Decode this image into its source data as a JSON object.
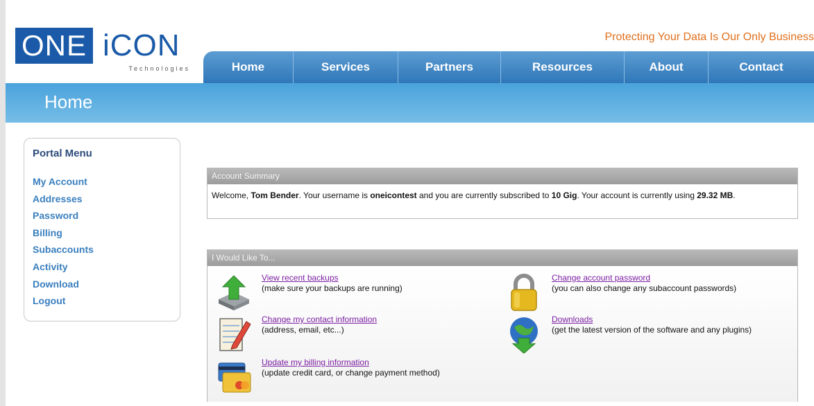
{
  "brand": {
    "logo_one": "ONE",
    "logo_icon": "iCON",
    "logo_sub": "Technologies",
    "tagline": "Protecting Your Data Is Our Only Business",
    "colors": {
      "brand_blue": "#1a5aa8",
      "tagline_orange": "#e0701c",
      "nav_blue": "#2f77b8",
      "banner_blue": "#4aa3dc",
      "link_purple": "#7b1fa2"
    }
  },
  "nav": {
    "items": [
      {
        "label": "Home"
      },
      {
        "label": "Services"
      },
      {
        "label": "Partners"
      },
      {
        "label": "Resources"
      },
      {
        "label": "About"
      },
      {
        "label": "Contact"
      }
    ]
  },
  "banner": {
    "title": "Home"
  },
  "sidebar": {
    "title": "Portal Menu",
    "items": [
      {
        "label": "My Account"
      },
      {
        "label": "Addresses"
      },
      {
        "label": "Password"
      },
      {
        "label": "Billing"
      },
      {
        "label": "Subaccounts"
      },
      {
        "label": "Activity"
      },
      {
        "label": "Download"
      },
      {
        "label": "Logout"
      }
    ]
  },
  "summary": {
    "header": "Account Summary",
    "welcome": "Welcome, ",
    "name": "Tom Bender",
    "text1": ". Your username is ",
    "username": "oneicontest",
    "text2": " and you are currently subscribed to ",
    "plan": "10 Gig",
    "text3": ". Your account is currently using ",
    "usage": "29.32 MB",
    "text4": "."
  },
  "actions": {
    "header": "I Would Like To...",
    "items": [
      {
        "icon": "backup-upload-icon",
        "link": "View recent backups",
        "desc": "(make sure your backups are running)"
      },
      {
        "icon": "lock-icon",
        "link": "Change account password",
        "desc": "(you can also change any subaccount passwords)"
      },
      {
        "icon": "notepad-pencil-icon",
        "link": "Change my contact information",
        "desc": "(address, email, etc...)"
      },
      {
        "icon": "globe-download-icon",
        "link": "Downloads",
        "desc": "(get the latest version of the software and any plugins)"
      },
      {
        "icon": "credit-card-icon",
        "link": "Update my billing information",
        "desc": "(update credit card, or change payment method)"
      }
    ]
  }
}
